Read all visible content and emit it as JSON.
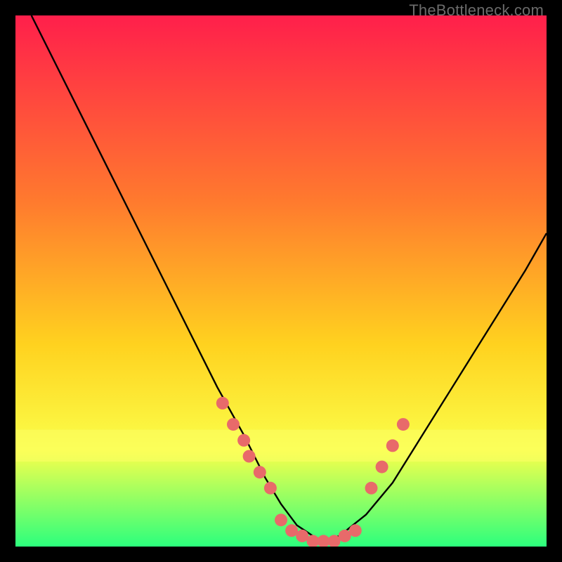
{
  "watermark": "TheBottleneck.com",
  "colors": {
    "gradient_top": "#ff1f4b",
    "gradient_mid1": "#ff7a2e",
    "gradient_mid2": "#ffd21f",
    "gradient_mid3": "#faff4a",
    "gradient_bottom": "#2cff7d",
    "curve": "#000000",
    "dots": "#e86a6a",
    "frame_bg": "#000000"
  },
  "chart_data": {
    "type": "line",
    "title": "",
    "xlabel": "",
    "ylabel": "",
    "xlim": [
      0,
      100
    ],
    "ylim": [
      0,
      100
    ],
    "series": [
      {
        "name": "bottleneck-curve",
        "x": [
          3,
          8,
          13,
          18,
          23,
          28,
          33,
          38,
          43,
          47,
          50,
          53,
          56,
          58,
          61,
          66,
          71,
          76,
          81,
          86,
          91,
          96,
          100
        ],
        "values": [
          100,
          90,
          80,
          70,
          60,
          50,
          40,
          30,
          21,
          13,
          8,
          4,
          2,
          1,
          2,
          6,
          12,
          20,
          28,
          36,
          44,
          52,
          59
        ]
      }
    ],
    "dot_clusters": [
      {
        "name": "left-ramp-dots",
        "x": [
          39,
          41,
          43,
          44,
          46,
          48
        ],
        "values": [
          27,
          23,
          20,
          17,
          14,
          11
        ]
      },
      {
        "name": "valley-floor-dots",
        "x": [
          50,
          52,
          54,
          56,
          58,
          60,
          62,
          64
        ],
        "values": [
          5,
          3,
          2,
          1,
          1,
          1,
          2,
          3
        ]
      },
      {
        "name": "right-ramp-dots",
        "x": [
          67,
          69,
          71,
          73
        ],
        "values": [
          11,
          15,
          19,
          23
        ]
      }
    ],
    "yellow_band": {
      "y_low": 16,
      "y_high": 22
    }
  }
}
